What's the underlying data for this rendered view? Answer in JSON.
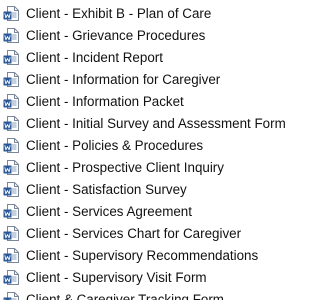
{
  "files": [
    {
      "name": "Client - Exhibit B - Plan of Care",
      "icon": "word-document-icon"
    },
    {
      "name": "Client - Grievance Procedures",
      "icon": "word-document-icon"
    },
    {
      "name": "Client - Incident Report",
      "icon": "word-document-icon"
    },
    {
      "name": "Client - Information for Caregiver",
      "icon": "word-document-icon"
    },
    {
      "name": "Client - Information Packet",
      "icon": "word-document-icon"
    },
    {
      "name": "Client - Initial Survey and Assessment Form",
      "icon": "word-document-icon"
    },
    {
      "name": "Client - Policies & Procedures",
      "icon": "word-document-icon"
    },
    {
      "name": "Client - Prospective Client Inquiry",
      "icon": "word-document-icon"
    },
    {
      "name": "Client - Satisfaction Survey",
      "icon": "word-document-icon"
    },
    {
      "name": "Client - Services Agreement",
      "icon": "word-document-icon"
    },
    {
      "name": "Client - Services Chart for Caregiver",
      "icon": "word-document-icon"
    },
    {
      "name": "Client - Supervisory Recommendations",
      "icon": "word-document-icon"
    },
    {
      "name": "Client - Supervisory Visit Form",
      "icon": "word-document-icon"
    },
    {
      "name": "Client & Caregiver Tracking Form",
      "icon": "word-document-icon"
    }
  ],
  "colors": {
    "icon_page": "#ffffff",
    "icon_border": "#7a8699",
    "icon_lines": "#8aa0bd",
    "icon_badge": "#2b5797"
  }
}
